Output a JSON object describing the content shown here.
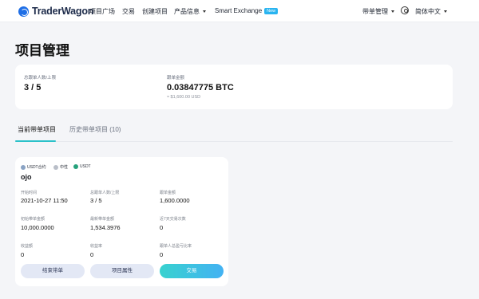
{
  "nav": {
    "brand": "TraderWagon",
    "items": [
      "项目广场",
      "交易",
      "创建项目",
      "产品信息"
    ],
    "smart_exchange": "Smart Exchange",
    "new_badge": "New",
    "trade_manage": "带单管理",
    "language": "简体中文"
  },
  "page": {
    "title": "项目管理"
  },
  "summary": {
    "followers_label": "总跟单人数/上限",
    "followers_value": "3 / 5",
    "amount_label": "跟单金额",
    "amount_value": "0.03847775 BTC",
    "amount_sub": "≈ $1,600.00 USD"
  },
  "tabs": {
    "current": "当前带单项目",
    "history": "历史带单项目 (10)"
  },
  "card": {
    "tags": [
      "USDT合约",
      "中性",
      "USDT"
    ],
    "name": "ojo",
    "fields": [
      {
        "label": "开始时间",
        "value": "2021-10-27 11:50"
      },
      {
        "label": "总跟单人数/上限",
        "value": "3 / 5"
      },
      {
        "label": "跟单金额",
        "value": "1,600.0000"
      },
      {
        "label": "初始带单金额",
        "value": "10,000.0000"
      },
      {
        "label": "最新带单金额",
        "value": "1,534.3976"
      },
      {
        "label": "近7天交易次数",
        "value": "0"
      },
      {
        "label": "收益额",
        "value": "0"
      },
      {
        "label": "收益率",
        "value": "0"
      },
      {
        "label": "跟单人总盈亏比率",
        "value": "0"
      }
    ],
    "buttons": {
      "end": "结束带单",
      "props": "项目属性",
      "trade": "交易"
    }
  },
  "colors": {
    "accent": "#2bc1c9",
    "brand": "#1f6fe6",
    "badge": "#29b4f0"
  }
}
